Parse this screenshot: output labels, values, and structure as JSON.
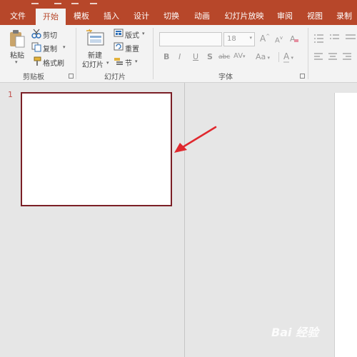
{
  "tabs": [
    {
      "label": "文件",
      "active": false
    },
    {
      "label": "开始",
      "active": true
    },
    {
      "label": "模板",
      "active": false
    },
    {
      "label": "插入",
      "active": false
    },
    {
      "label": "设计",
      "active": false
    },
    {
      "label": "切换",
      "active": false
    },
    {
      "label": "动画",
      "active": false
    },
    {
      "label": "幻灯片放映",
      "active": false
    },
    {
      "label": "审阅",
      "active": false
    },
    {
      "label": "视图",
      "active": false
    },
    {
      "label": "录制",
      "active": false
    }
  ],
  "clipboard": {
    "paste": "粘贴",
    "cut": "剪切",
    "copy": "复制",
    "format_painter": "格式刷",
    "group_name": "剪贴板"
  },
  "slides": {
    "new_slide_line1": "新建",
    "new_slide_line2": "幻灯片",
    "layout": "版式",
    "reset": "重置",
    "section": "节",
    "group_name": "幻灯片"
  },
  "font": {
    "font_name": "",
    "font_size": "18",
    "grow": "A",
    "shrink": "A",
    "bold": "B",
    "italic": "I",
    "underline": "U",
    "shadow": "S",
    "strikethrough": "abc",
    "spacing": "AV",
    "change_case": "Aa",
    "font_color": "A",
    "group_name": "字体"
  },
  "thumbnail_pane": {
    "slide_number": "1"
  },
  "watermark": "Bai 经验",
  "colors": {
    "accent": "#b7472a",
    "selection_border": "#7b1f26",
    "arrow": "#e0282e"
  }
}
